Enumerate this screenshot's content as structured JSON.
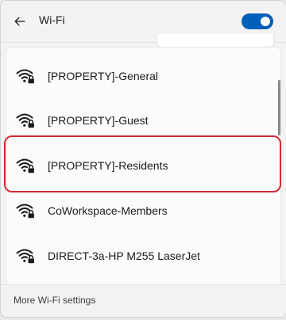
{
  "header": {
    "title": "Wi-Fi",
    "wifi_enabled": true
  },
  "networks": [
    {
      "ssid": "[PROPERTY]-General",
      "secured": true
    },
    {
      "ssid": "[PROPERTY]-Guest",
      "secured": true
    },
    {
      "ssid": "[PROPERTY]-Residents",
      "secured": true,
      "highlighted": true
    },
    {
      "ssid": "CoWorkspace-Members",
      "secured": true
    },
    {
      "ssid": "DIRECT-3a-HP M255 LaserJet",
      "secured": true
    }
  ],
  "footer": {
    "more_settings_label": "More Wi-Fi settings"
  },
  "colors": {
    "accent": "#005fb8",
    "highlight": "#d22a35"
  },
  "icons": {
    "back": "back-arrow-icon",
    "network": "wifi-secured-icon"
  }
}
